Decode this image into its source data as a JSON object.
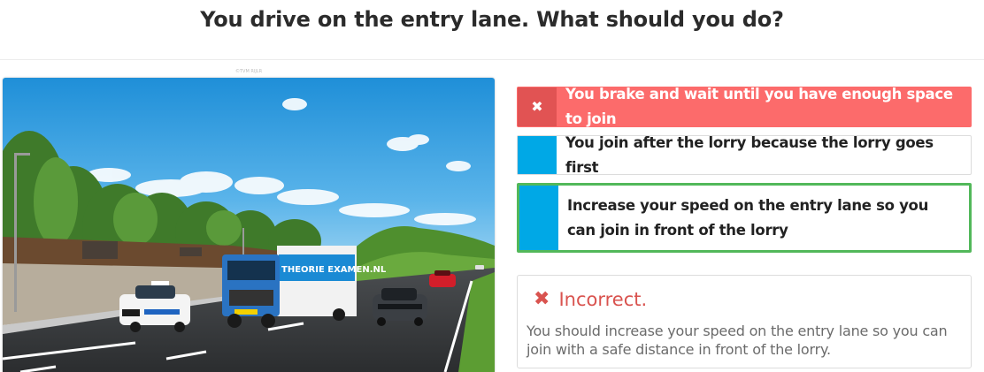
{
  "question": "You drive on the entry lane. What should you do?",
  "image": {
    "copyright": "©TVM RIJLR",
    "truck_brand": "THEORIE EXAMEN.NL"
  },
  "answers": [
    {
      "marker": "✖",
      "text": "You brake and wait until you have enough space to join",
      "state": "selected-wrong"
    },
    {
      "marker": "",
      "text": "You join after the lorry because the lorry goes first",
      "state": "normal"
    },
    {
      "marker": "",
      "text": "Increase your speed on the entry lane so you can join in front of the lorry",
      "state": "correct"
    }
  ],
  "feedback": {
    "icon": "✖",
    "title": "Incorrect.",
    "explanation": "You should increase your speed on the entry lane so you can join with a safe distance in front of the lorry."
  },
  "colors": {
    "wrong_bg": "#fc6b6b",
    "wrong_marker": "#e15353",
    "marker_blue": "#00a8e6",
    "correct_border": "#52b85a",
    "feedback_red": "#d9534f"
  }
}
